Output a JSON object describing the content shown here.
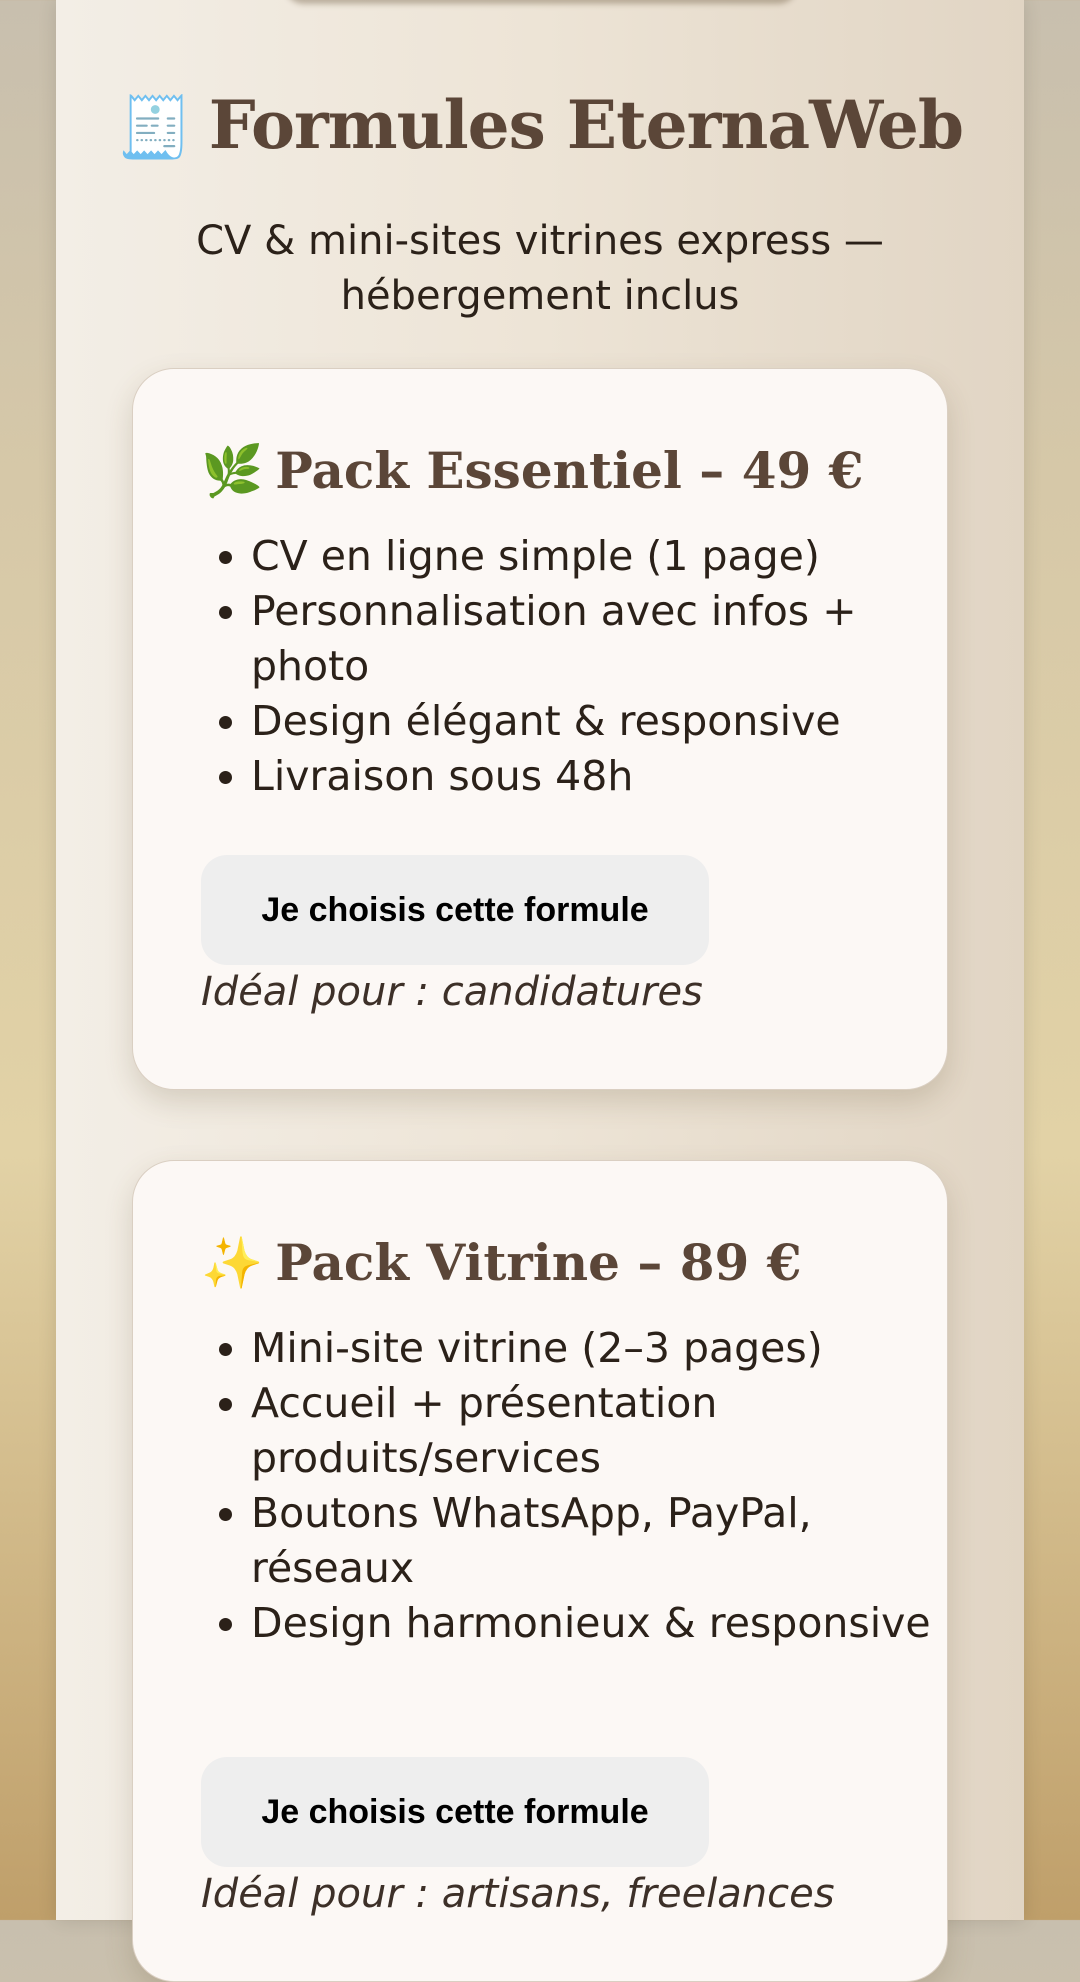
{
  "header": {
    "icon": "receipt-icon",
    "title": "Formules EternaWeb",
    "subtitle": "CV & mini-sites vitrines express — hébergement inclus"
  },
  "packs": [
    {
      "icon": "herb-icon",
      "title": "Pack Essentiel – 49 €",
      "features": [
        "CV en ligne simple (1 page)",
        "Personnalisation avec infos + photo",
        "Design élégant & responsive",
        "Livraison sous 48h"
      ],
      "button_label": "Je choisis cette formule",
      "ideal": "Idéal pour : candidatures"
    },
    {
      "icon": "sparkles-icon",
      "title": "Pack Vitrine – 89 €",
      "features": [
        "Mini-site vitrine (2–3 pages)",
        "Accueil + présentation produits/services",
        "Boutons WhatsApp, PayPal, réseaux",
        "Design harmonieux & responsive"
      ],
      "button_label": "Je choisis cette formule",
      "ideal": "Idéal pour : artisans, freelances"
    }
  ],
  "colors": {
    "heading": "#5b4638",
    "text": "#2b2119",
    "card_background": "#fcf8f5",
    "button_background": "#eeeeee"
  }
}
